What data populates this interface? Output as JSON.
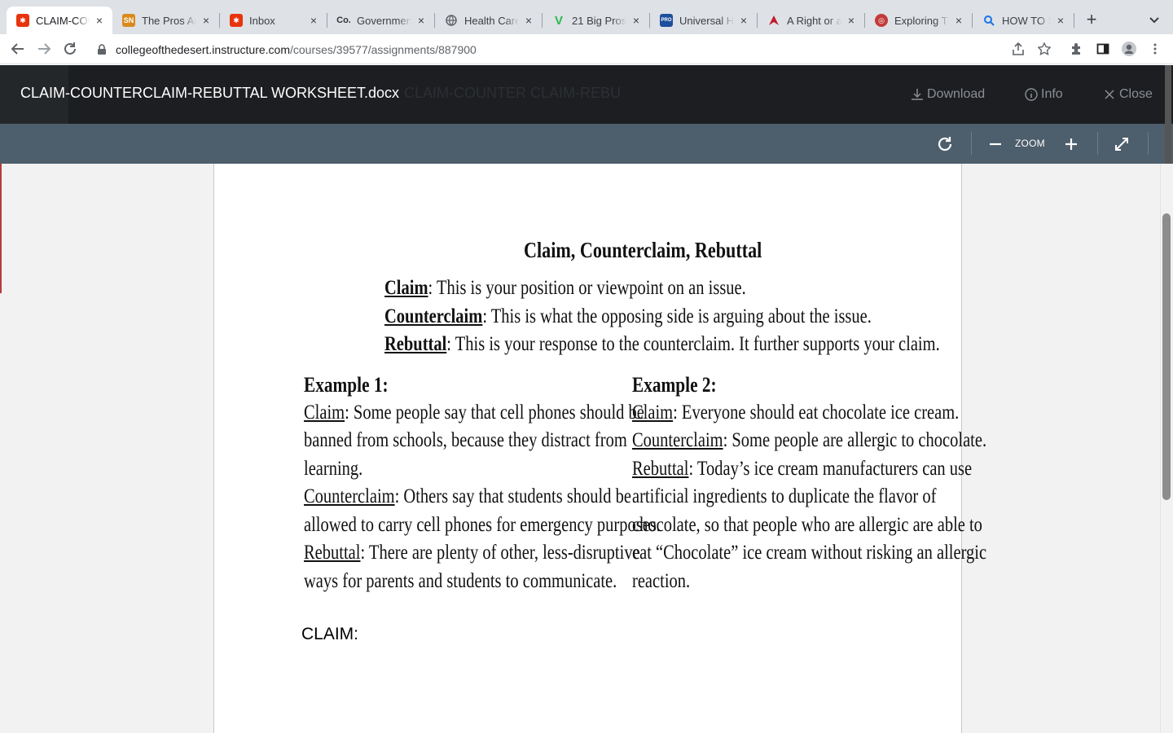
{
  "browser": {
    "tabs": [
      {
        "title": "CLAIM-COUNTERCLAIM-REBUTTAL",
        "icon": "canvas-icon",
        "color": "#e8340e",
        "active": true
      },
      {
        "title": "The Pros And Cons",
        "icon": "sn-icon",
        "color": "#d98a1c"
      },
      {
        "title": "Inbox",
        "icon": "canvas-icon",
        "color": "#e8340e"
      },
      {
        "title": "Government Health Care",
        "icon": "co-icon",
        "color": "#333333"
      },
      {
        "title": "Health Care",
        "icon": "globe-icon",
        "color": "#5f6368"
      },
      {
        "title": "21 Big Pros",
        "icon": "v-icon",
        "color": "#2fb84a"
      },
      {
        "title": "Universal Health",
        "icon": "procon-icon",
        "color": "#1d4f9c"
      },
      {
        "title": "A Right or a",
        "icon": "arrow-icon",
        "color": "#c3182a"
      },
      {
        "title": "Exploring The",
        "icon": "seal-icon",
        "color": "#c33a3a"
      },
      {
        "title": "HOW TO SOLVE",
        "icon": "search-icon",
        "color": "#1a73e8"
      }
    ],
    "close_glyph": "×",
    "new_tab_glyph": "+",
    "url_host": "collegeofthedesert.instructure.com",
    "url_path": "/courses/39577/assignments/887900"
  },
  "viewer": {
    "file_name": "CLAIM-COUNTERCLAIM-REBUTTAL WORKSHEET.docx",
    "file_name_ghost": "CLAIM-COUNTER CLAIM-REBU",
    "download_label": "Download",
    "info_label": "Info",
    "close_label": "Close",
    "zoom_label": "ZOOM"
  },
  "document": {
    "heading": "Claim, Counterclaim, Rebuttal",
    "definitions": [
      {
        "term": "Claim",
        "text": ": This is your position or viewpoint on an issue."
      },
      {
        "term": "Counterclaim",
        "text": ": This is what the opposing side is arguing about the issue."
      },
      {
        "term": "Rebuttal",
        "text": ": This is your response to the counterclaim. It further supports your claim."
      }
    ],
    "example1": {
      "heading": "Example 1:",
      "lines": [
        {
          "term": "Claim",
          "text": ": Some people say that cell phones should be"
        },
        {
          "term": "",
          "text": "banned from schools, because they distract from"
        },
        {
          "term": "",
          "text": "learning."
        },
        {
          "term": "Counterclaim",
          "text": ": Others say that students should be"
        },
        {
          "term": "",
          "text": "allowed to carry cell phones for emergency purposes."
        },
        {
          "term": "Rebuttal",
          "text": ": There are plenty of other, less-disruptive"
        },
        {
          "term": "",
          "text": "ways for parents and students to communicate."
        }
      ]
    },
    "example2": {
      "heading": "Example 2:",
      "lines": [
        {
          "term": "Claim",
          "text": ": Everyone should eat chocolate ice cream."
        },
        {
          "term": "Counterclaim",
          "text": ": Some people are allergic to chocolate."
        },
        {
          "term": "Rebuttal",
          "text": ": Today’s ice cream manufacturers can use"
        },
        {
          "term": "",
          "text": "artificial ingredients to duplicate the flavor of"
        },
        {
          "term": "",
          "text": "chocolate, so that people who are allergic are able to"
        },
        {
          "term": "",
          "text": "eat “Chocolate” ice cream without risking an allergic"
        },
        {
          "term": "",
          "text": "reaction."
        }
      ]
    },
    "claim_label": "CLAIM:"
  }
}
